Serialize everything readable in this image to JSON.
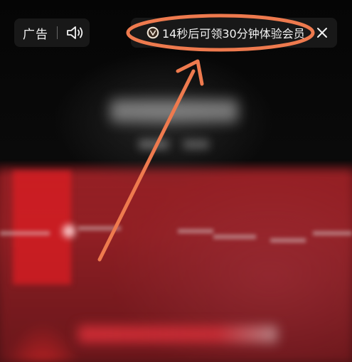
{
  "ad_bar": {
    "label": "广告",
    "sound_icon": "speaker-icon"
  },
  "reward_bar": {
    "icon": "vip-badge-icon",
    "text": "14秒后可领30分钟体验会员",
    "close_icon": "close-icon"
  },
  "annotation": {
    "color": "#ee7a4e"
  }
}
